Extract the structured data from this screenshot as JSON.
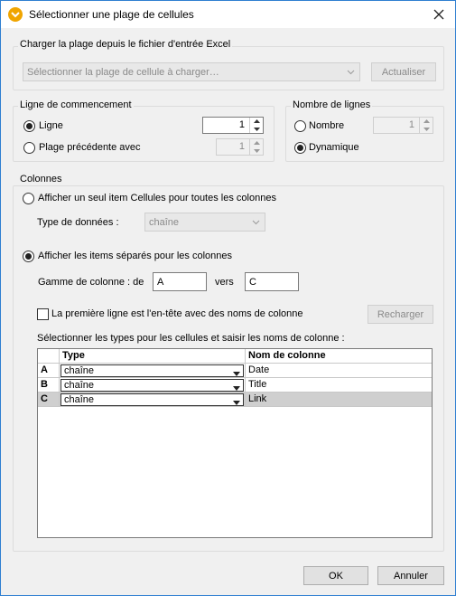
{
  "window": {
    "title": "Sélectionner une plage de cellules"
  },
  "load_group": {
    "legend": "Charger la plage depuis le fichier d'entrée Excel",
    "combo_value": "Sélectionner la plage de cellule à charger…",
    "refresh_label": "Actualiser"
  },
  "start_line": {
    "legend": "Ligne de commencement",
    "line_label": "Ligne",
    "line_value": "1",
    "previous_label": "Plage précédente avec",
    "previous_value": "1"
  },
  "line_count": {
    "legend": "Nombre de lignes",
    "number_label": "Nombre",
    "number_value": "1",
    "dynamic_label": "Dynamique"
  },
  "columns": {
    "legend": "Colonnes",
    "single_item_label": "Afficher un seul item Cellules pour toutes les colonnes",
    "data_type_label": "Type de données :",
    "data_type_value": "chaîne",
    "separate_items_label": "Afficher les items séparés pour les colonnes",
    "range_label": "Gamme de colonne : de",
    "range_from": "A",
    "range_to_label": "vers",
    "range_to": "C",
    "header_row_label": "La première ligne est l'en-tête avec des noms de colonne",
    "reload_label": "Recharger",
    "grid_caption": "Sélectionner les types pour les cellules et saisir les noms de colonne :",
    "grid_headers": {
      "type": "Type",
      "name": "Nom de colonne"
    },
    "rows": [
      {
        "letter": "A",
        "type": "chaîne",
        "name": "Date"
      },
      {
        "letter": "B",
        "type": "chaîne",
        "name": "Title"
      },
      {
        "letter": "C",
        "type": "chaîne",
        "name": "Link"
      }
    ]
  },
  "footer": {
    "ok_label": "OK",
    "cancel_label": "Annuler"
  },
  "state": {
    "start_line_selected": "line",
    "line_count_selected": "dynamic",
    "columns_selected": "separate",
    "selected_row": "C"
  }
}
